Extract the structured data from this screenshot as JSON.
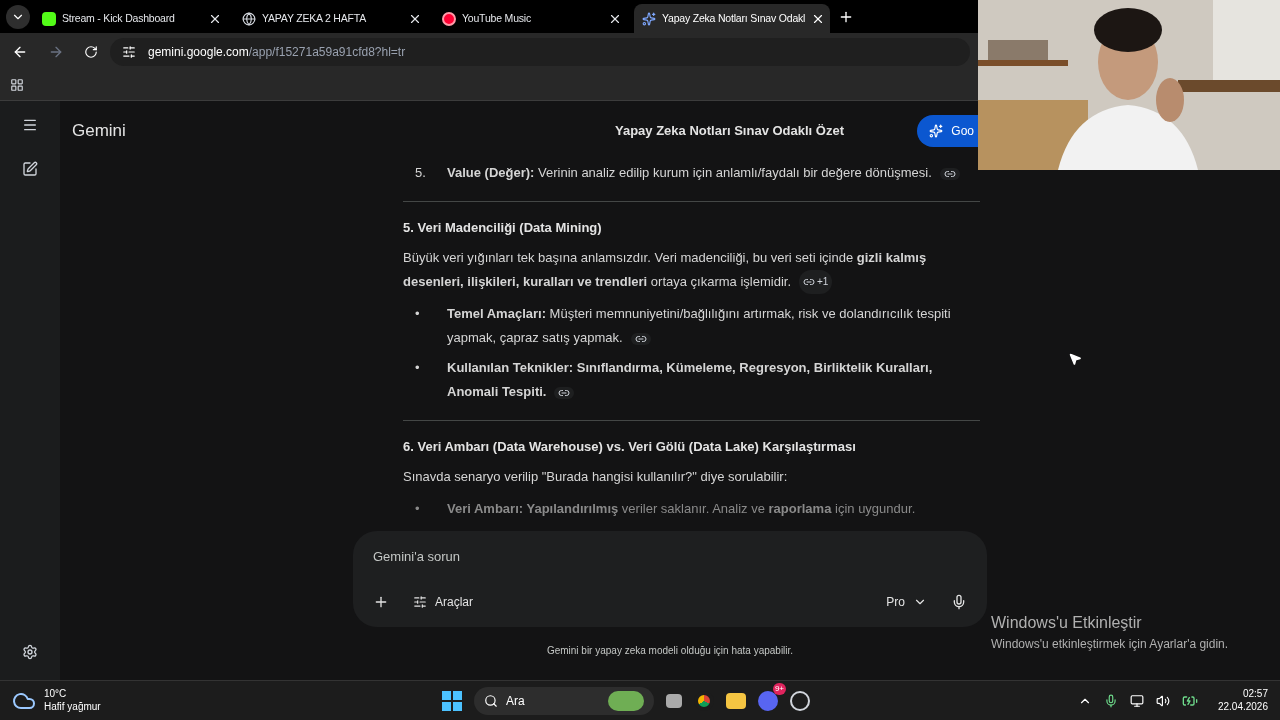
{
  "tabs": [
    {
      "label": "Stream - Kick Dashboard",
      "selected": false
    },
    {
      "label": "YAPAY ZEKA 2 HAFTA",
      "selected": false
    },
    {
      "label": "YouTube Music",
      "selected": false
    },
    {
      "label": "Yapay Zeka Notları Sınav Odakl",
      "selected": true
    }
  ],
  "address": {
    "host": "gemini.google.com",
    "path": "/app/f15271a59a91cfd8?hl=tr"
  },
  "app": {
    "name": "Gemini",
    "title": "Yapay Zeka Notları Sınav Odaklı Özet",
    "header_button": "Goo"
  },
  "content": [
    {
      "kind": "numbered",
      "number": "5.",
      "text": "**Value (Değer):** Verinin analiz edilip kurum için anlamlı/faydalı bir değere dönüşmesi.",
      "link": true
    },
    {
      "kind": "rule"
    },
    {
      "kind": "heading",
      "text": "5. Veri Madenciliği (Data Mining)"
    },
    {
      "kind": "paragraph",
      "text": "Büyük veri yığınları tek başına anlamsızdır. Veri madenciliği, bu veri seti içinde **gizli kalmış desenleri, ilişkileri, kuralları ve trendleri** ortaya çıkarma işlemidir.",
      "link": true,
      "sources": "+1"
    },
    {
      "kind": "bullet",
      "bullet": "•",
      "text": "**Temel Amaçları:** Müşteri memnuniyetini/bağlılığını artırmak, risk ve dolandırıcılık tespiti yapmak, çapraz satış yapmak.",
      "link": true
    },
    {
      "kind": "bullet",
      "bullet": "•",
      "text": "**Kullanılan Teknikler: Sınıflandırma, Kümeleme, Regresyon, Birliktelik Kuralları, Anomali Tespiti.**",
      "link": true
    },
    {
      "kind": "rule"
    },
    {
      "kind": "heading",
      "text": "6. Veri Ambarı (Data Warehouse) vs. Veri Gölü (Data Lake) Karşılaştırması"
    },
    {
      "kind": "paragraph",
      "text": "Sınavda senaryo verilip \"Burada hangisi kullanılır?\" diye sorulabilir:"
    },
    {
      "kind": "bullet",
      "bullet": "•",
      "faded": true,
      "text": "**Veri Ambarı: Yapılandırılmış** veriler saklanır. Analiz ve **raporlama** için uygundur."
    }
  ],
  "prompt": {
    "placeholder": "Gemini'a sorun",
    "tools": "Araçlar",
    "model": "Pro"
  },
  "disclaimer": "Gemini bir yapay zeka modeli olduğu için hata yapabilir.",
  "activation": {
    "title": "Windows'u Etkinleştir",
    "text": "Windows'u etkinleştirmek için Ayarlar'a gidin."
  },
  "taskbar": {
    "temp": "10°C",
    "weather": "Hafif yağmur",
    "search": "Ara",
    "discord_badge": "9+",
    "time": "02:57",
    "date": "22.04.2026"
  }
}
